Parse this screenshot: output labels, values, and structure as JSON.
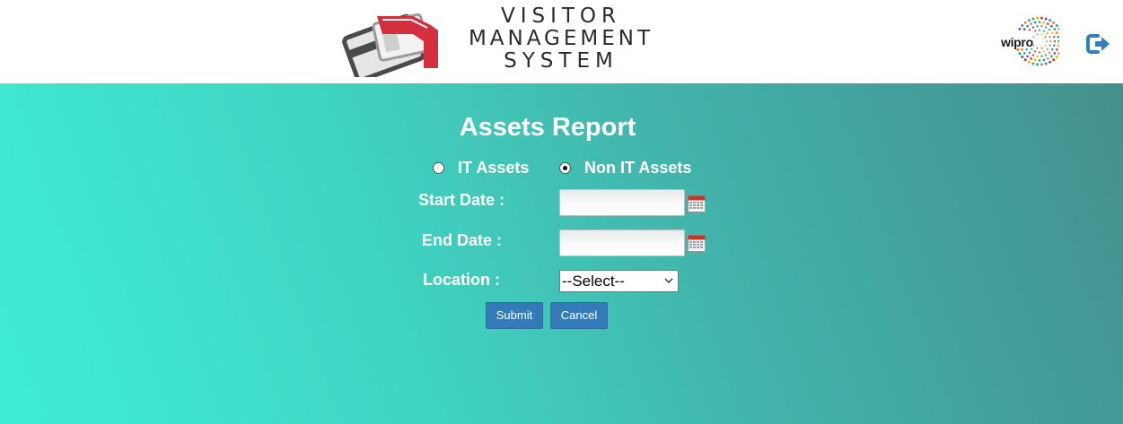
{
  "header": {
    "logo_lines": [
      "VISITOR",
      "MANAGEMENT",
      "SYSTEM"
    ],
    "brand": "wipro",
    "logout_icon": "sign-out-icon"
  },
  "form": {
    "title": "Assets Report",
    "asset_type": {
      "options": [
        "IT Assets",
        "Non IT Assets"
      ],
      "selected": "Non IT Assets"
    },
    "start_date_label": "Start Date :",
    "start_date_value": "",
    "end_date_label": "End Date :",
    "end_date_value": "",
    "calendar_icon": "calendar-icon",
    "location_label": "Location :",
    "location_selected": "--Select--",
    "submit_label": "Submit",
    "cancel_label": "Cancel"
  },
  "colors": {
    "primary_button": "#337ab7",
    "gradient_start": "#3eedd5",
    "gradient_end": "#448f8e",
    "logo_red": "#d32f3d"
  }
}
